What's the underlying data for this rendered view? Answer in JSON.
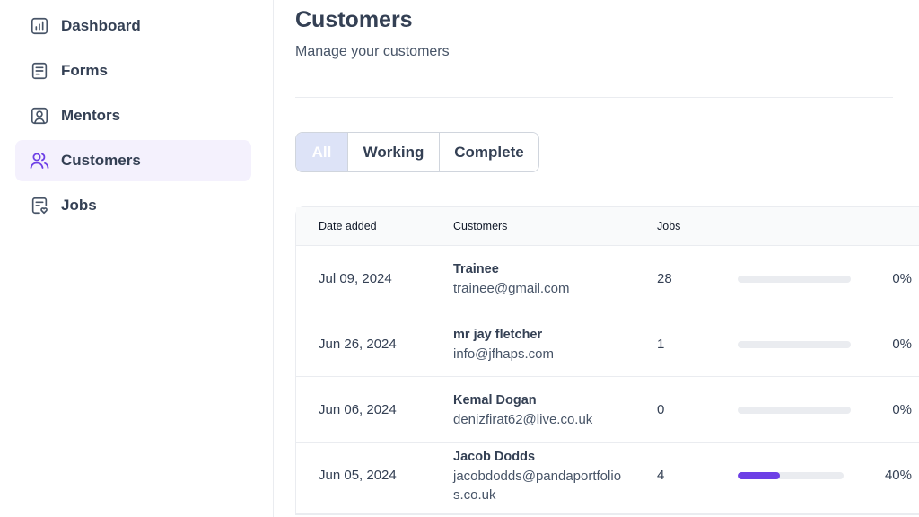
{
  "sidebar": {
    "items": [
      {
        "label": "Dashboard",
        "icon": "chart-bar-icon",
        "active": false
      },
      {
        "label": "Forms",
        "icon": "document-icon",
        "active": false
      },
      {
        "label": "Mentors",
        "icon": "user-square-icon",
        "active": false
      },
      {
        "label": "Customers",
        "icon": "users-icon",
        "active": true
      },
      {
        "label": "Jobs",
        "icon": "clipboard-heart-icon",
        "active": false
      }
    ]
  },
  "header": {
    "title": "Customers",
    "subtitle": "Manage your customers"
  },
  "filters": {
    "all": "All",
    "working": "Working",
    "complete": "Complete",
    "selected": "All"
  },
  "table": {
    "headers": {
      "date": "Date added",
      "customers": "Customers",
      "jobs": "Jobs"
    },
    "rows": [
      {
        "date": "Jul 09, 2024",
        "name": "Trainee",
        "email": "trainee@gmail.com",
        "jobs": "28",
        "progress": 0,
        "progress_label": "0%"
      },
      {
        "date": "Jun 26, 2024",
        "name": "mr jay fletcher",
        "email": "info@jfhaps.com",
        "jobs": "1",
        "progress": 0,
        "progress_label": "0%"
      },
      {
        "date": "Jun 06, 2024",
        "name": "Kemal Dogan",
        "email": "denizfirat62@live.co.uk",
        "jobs": "0",
        "progress": 0,
        "progress_label": "0%"
      },
      {
        "date": "Jun 05, 2024",
        "name": "Jacob Dodds",
        "email": "jacobdodds@pandaportfolios.co.uk",
        "jobs": "4",
        "progress": 40,
        "progress_label": "40%"
      }
    ]
  },
  "colors": {
    "accent": "#6d3fe6",
    "active_bg": "#f4f1fd",
    "filter_selected_bg": "#dde3f7"
  }
}
